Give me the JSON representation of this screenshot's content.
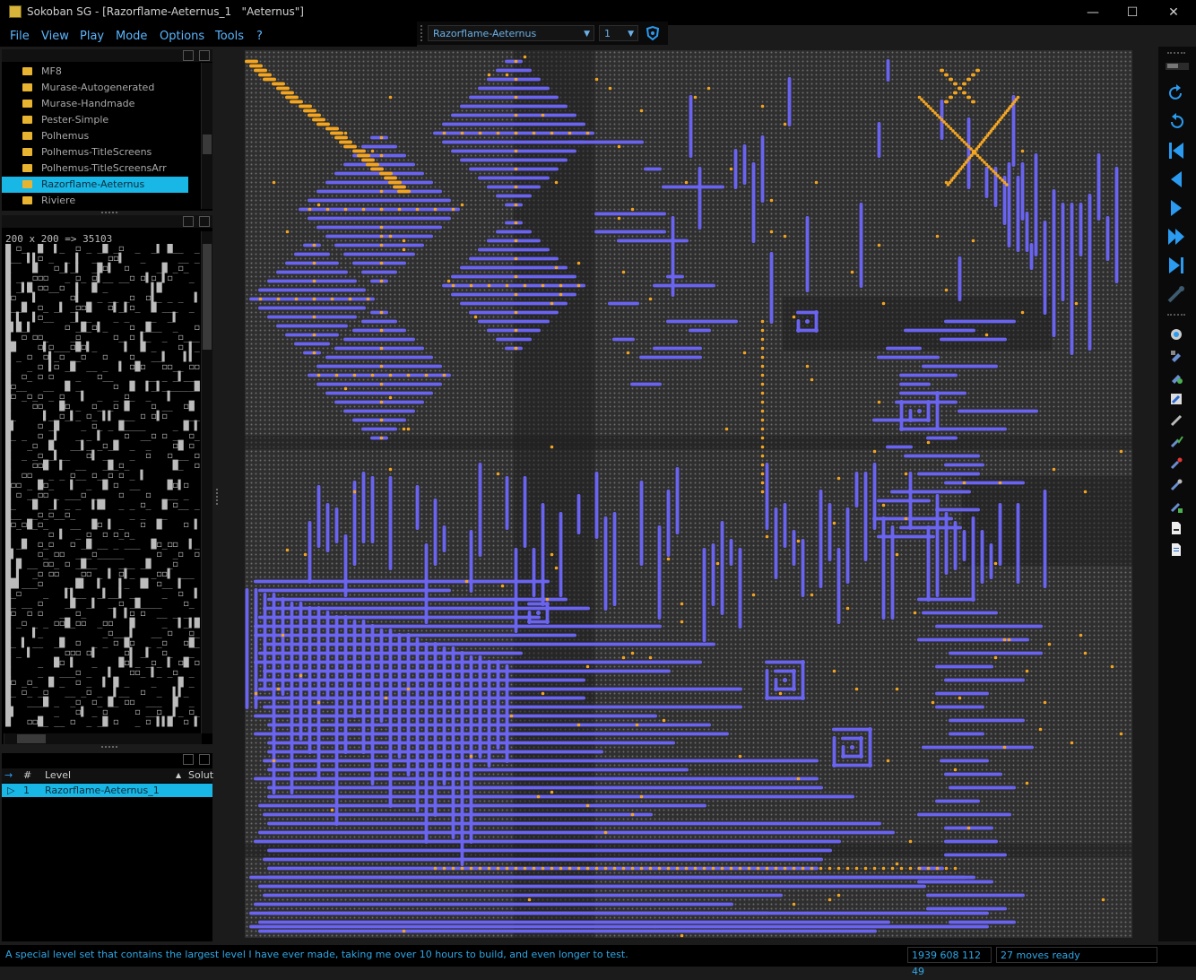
{
  "window": {
    "title": "Sokoban SG - [Razorflame-Aeternus_1   \"Aeternus\"]",
    "min_glyph": "—",
    "max_glyph": "☐",
    "close_glyph": "✕"
  },
  "menu": {
    "items": [
      "File",
      "View",
      "Play",
      "Mode",
      "Options",
      "Tools",
      "?"
    ]
  },
  "toolbar": {
    "collection_select": "Razorflame-Aeternus",
    "level_select": "1"
  },
  "collections": {
    "items": [
      "MF8",
      "Murase-Autogenerated",
      "Murase-Handmade",
      "Pester-Simple",
      "Polhemus",
      "Polhemus-TitleScreens",
      "Polhemus-TitleScreensArr",
      "Razorflame-Aeternus",
      "Riviere"
    ],
    "selected_index": 7
  },
  "preview": {
    "header": "200 x 200 => 35103"
  },
  "levels": {
    "col_arrow": "→",
    "col_num": "#",
    "col_level": "Level",
    "col_sort": "▲",
    "col_solution": "Solut",
    "rows": [
      {
        "marker": "▷",
        "num": "1",
        "name": "Razorflame-Aeternus_1"
      }
    ]
  },
  "status": {
    "message": "A special level set that contains the largest level I have ever made, taking me over 10 hours to build, and even longer to test.",
    "counts": "1939 608 112 49",
    "moves": "27  moves ready"
  },
  "colors": {
    "wall": "#6a64f0",
    "goal": "#f4a623",
    "floor": "#3c3c3c",
    "accent": "#19b7e6"
  },
  "icons": {
    "undo": "undo-icon",
    "redo": "redo-icon",
    "first": "first-level-icon",
    "prev": "previous-level-icon",
    "next": "next-level-icon",
    "next_unsolved": "next-unsolved-icon",
    "last": "last-level-icon"
  }
}
